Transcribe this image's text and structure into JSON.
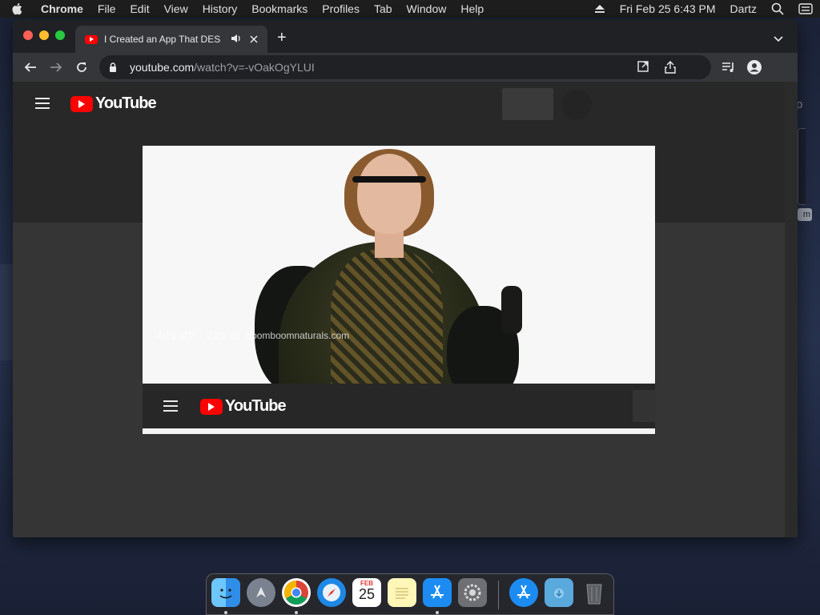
{
  "menubar": {
    "apple_icon": "apple-logo",
    "app_name": "Chrome",
    "menus": [
      "File",
      "Edit",
      "View",
      "History",
      "Bookmarks",
      "Profiles",
      "Tab",
      "Window",
      "Help"
    ],
    "status_icon": "eject-icon",
    "datetime": "Fri Feb 25  6:43 PM",
    "user": "Dartz",
    "search_icon": "spotlight-search-icon",
    "control_icon": "control-center-icon"
  },
  "desktop": {
    "right_partial_letter": "p",
    "right_partial_badge": "m"
  },
  "browser": {
    "tab": {
      "title": "I Created an App That DES",
      "favicon": "youtube-favicon",
      "audio_icon": "speaker-icon",
      "close_icon": "close-icon"
    },
    "new_tab_label": "+",
    "url_host": "youtube.com",
    "url_path": "/watch?v=-vOakOgYLUI"
  },
  "youtube": {
    "logo_text": "YouTube",
    "ad": {
      "counter": "Ad 1 of 2",
      "time": "2:25",
      "advertiser": "boomboomnaturals.com"
    },
    "inner_logo_text": "YouTube"
  },
  "dock": {
    "apps": [
      "Finder",
      "Launchpad",
      "Google Chrome",
      "Safari",
      "Calendar",
      "Notes",
      "App Store",
      "System Preferences",
      "App Store",
      "Downloads",
      "Trash"
    ],
    "calendar_month": "FEB",
    "calendar_day": "25"
  },
  "colors": {
    "youtube_red": "#ff0000",
    "chrome_dark": "#202124",
    "page_dark": "#282828"
  }
}
